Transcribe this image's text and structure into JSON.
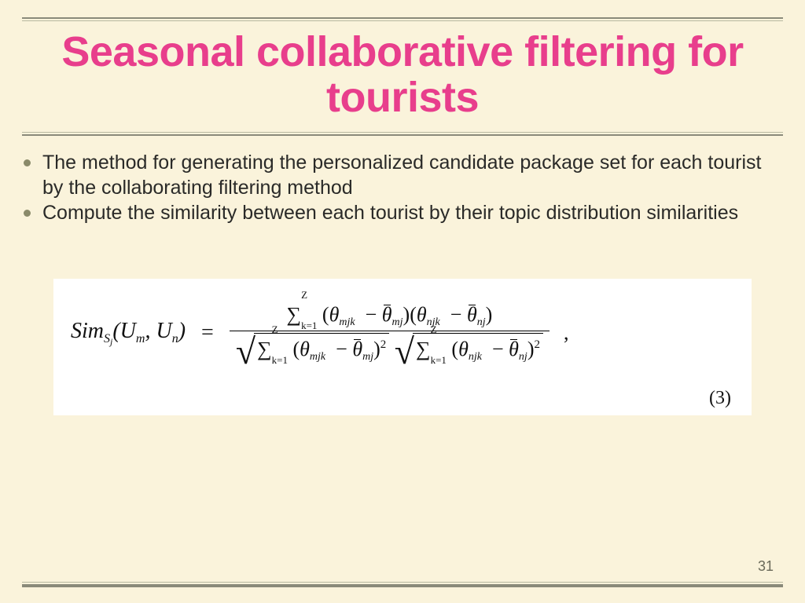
{
  "title": "Seasonal collaborative filtering for tourists",
  "bullets": [
    "The method for generating the personalized candidate package set for each tourist by the collaborating filtering method",
    "Compute the similarity between each tourist by their topic distribution similarities"
  ],
  "formula": {
    "lhs_func": "Sim",
    "lhs_sub": "S",
    "lhs_subsub": "j",
    "arg1": "U",
    "arg1_sub": "m",
    "arg2": "U",
    "arg2_sub": "n",
    "sum_upper": "Z",
    "sum_lower": "k=1",
    "theta": "θ",
    "idx_mjk": "mjk",
    "idx_mj": "mj",
    "idx_njk": "njk",
    "idx_nj": "nj",
    "eq_number": "(3)"
  },
  "page_number": "31"
}
